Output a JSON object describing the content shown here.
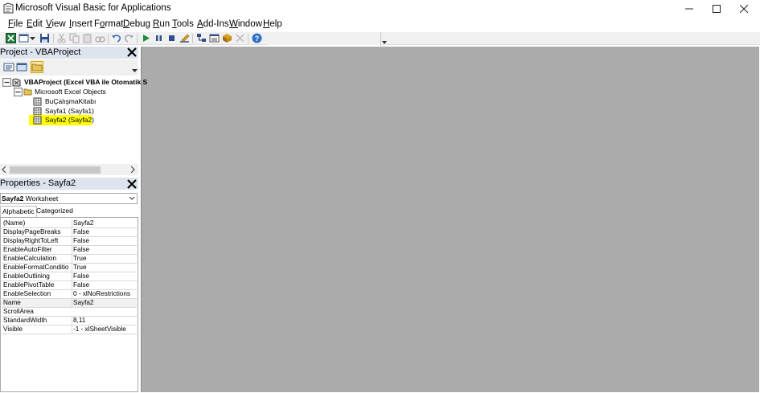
{
  "window": {
    "title": "Microsoft Visual Basic for Applications",
    "controls": {
      "minimize": "—",
      "maximize": "☐",
      "close": "✕"
    }
  },
  "menu": [
    {
      "label": "File",
      "accel": "F",
      "rest": "ile"
    },
    {
      "label": "Edit",
      "accel": "E",
      "rest": "dit"
    },
    {
      "label": "View",
      "accel": "V",
      "rest": "iew"
    },
    {
      "label": "Insert",
      "accel": "I",
      "rest": "nsert"
    },
    {
      "label": "Format",
      "accel": "o",
      "pre": "F",
      "rest": "rmat"
    },
    {
      "label": "Debug",
      "accel": "D",
      "rest": "ebug"
    },
    {
      "label": "Run",
      "accel": "R",
      "rest": "un"
    },
    {
      "label": "Tools",
      "accel": "T",
      "rest": "ools"
    },
    {
      "label": "Add-Ins",
      "accel": "A",
      "rest": "dd-Ins"
    },
    {
      "label": "Window",
      "accel": "W",
      "rest": "indow"
    },
    {
      "label": "Help",
      "accel": "H",
      "rest": "elp"
    }
  ],
  "toolbar": {
    "icons": [
      "view-excel-icon",
      "insert-module-icon",
      "save-icon",
      "cut-icon",
      "copy-icon",
      "paste-icon",
      "find-icon",
      "undo-icon",
      "redo-icon",
      "run-icon",
      "break-icon",
      "reset-icon",
      "design-mode-icon",
      "project-explorer-icon",
      "properties-window-icon",
      "object-browser-icon",
      "toolbox-icon",
      "help-icon"
    ]
  },
  "project_panel": {
    "title": "Project - VBAProject",
    "tree": [
      {
        "label": "VBAProject (Excel VBA ile Otomatik S",
        "level": 0,
        "bold": true
      },
      {
        "label": "Microsoft Excel Objects",
        "level": 1
      },
      {
        "label": "BuÇalışmaKitabı",
        "level": 2
      },
      {
        "label": "Sayfa1 (Sayfa1)",
        "level": 2
      },
      {
        "label": "Sayfa2 (Sayfa2)",
        "level": 2,
        "selected": true
      }
    ]
  },
  "properties_panel": {
    "title": "Properties - Sayfa2",
    "object_name": "Sayfa2",
    "object_type": "Worksheet",
    "tabs": [
      "Alphabetic",
      "Categorized"
    ],
    "rows": [
      {
        "name": "(Name)",
        "value": "Sayfa2"
      },
      {
        "name": "DisplayPageBreaks",
        "value": "False"
      },
      {
        "name": "DisplayRightToLeft",
        "value": "False"
      },
      {
        "name": "EnableAutoFilter",
        "value": "False"
      },
      {
        "name": "EnableCalculation",
        "value": "True"
      },
      {
        "name": "EnableFormatConditionsCalculation",
        "value": "True"
      },
      {
        "name": "EnableOutlining",
        "value": "False"
      },
      {
        "name": "EnablePivotTable",
        "value": "False"
      },
      {
        "name": "EnableSelection",
        "value": "0 - xlNoRestrictions"
      },
      {
        "name": "Name",
        "value": "Sayfa2"
      },
      {
        "name": "ScrollArea",
        "value": ""
      },
      {
        "name": "StandardWidth",
        "value": "8,11"
      },
      {
        "name": "Visible",
        "value": "-1 - xlSheetVisible"
      }
    ]
  }
}
